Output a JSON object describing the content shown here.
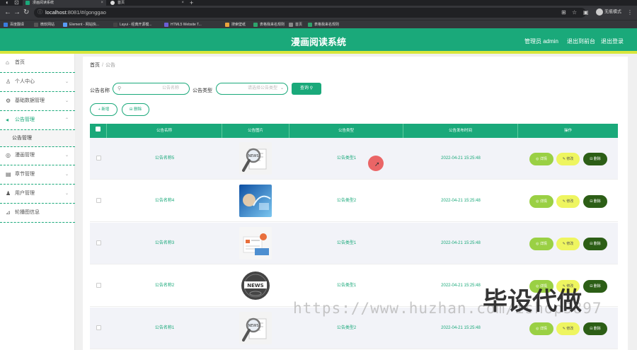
{
  "browser": {
    "tabs": [
      {
        "title": "漫画阅读系统",
        "active": true
      },
      {
        "title": "首页",
        "active": false
      }
    ],
    "url_host": "localhost",
    "url_rest": ":8081/#/gonggao",
    "profile_label": "无痕模式",
    "bookmarks": [
      {
        "label": "百度翻译",
        "icon": "translate-icon",
        "color": "#3b7ddd"
      },
      {
        "label": "微软网站",
        "icon": "windows-icon",
        "color": "#555"
      },
      {
        "label": "Element - 网站快...",
        "icon": "element-icon",
        "color": "#5a9cf5"
      },
      {
        "label": "Layui - 经典开源模...",
        "icon": "layui-icon",
        "color": "#444"
      },
      {
        "label": "HTML5 Website T...",
        "icon": "html5-icon",
        "color": "#6b5fd6"
      },
      {
        "label": "搜索壁纸",
        "icon": "wallpaper-icon",
        "color": "#e8a33c"
      },
      {
        "label": "表格我来名规则",
        "icon": "table-icon",
        "color": "#2fa36b"
      },
      {
        "label": "首页",
        "icon": "globe-icon",
        "color": "#888"
      },
      {
        "label": "表格我来名规则",
        "icon": "table-icon",
        "color": "#2fa36b"
      }
    ]
  },
  "app": {
    "title": "漫画阅读系统",
    "admin_label": "管理员 admin",
    "exit_backend": "退出到前台",
    "logout": "退出登录"
  },
  "sidebar": {
    "items": [
      {
        "label": "首页",
        "icon": "home-icon",
        "expandable": false
      },
      {
        "label": "个人中心",
        "icon": "user-icon",
        "expandable": true
      },
      {
        "label": "基础数据管理",
        "icon": "settings-icon",
        "expandable": true
      },
      {
        "label": "公告管理",
        "icon": "megaphone-icon",
        "expandable": true,
        "active": true
      },
      {
        "label": "漫画管理",
        "icon": "book-icon",
        "expandable": true
      },
      {
        "label": "章节管理",
        "icon": "chapter-icon",
        "expandable": true
      },
      {
        "label": "用户管理",
        "icon": "users-icon",
        "expandable": true
      },
      {
        "label": "轮播图信息",
        "icon": "carousel-icon",
        "expandable": false
      }
    ],
    "sub_item": "公告管理"
  },
  "breadcrumb": {
    "home": "首页",
    "sep": "/",
    "current": "公告"
  },
  "filters": {
    "name_label": "公告名称",
    "name_placeholder": "公告名称",
    "type_label": "公告类型",
    "type_placeholder": "请选择公告类型",
    "search_btn": "查询"
  },
  "ops": {
    "add": "新增",
    "delete": "删除"
  },
  "table": {
    "headers": [
      "公告名称",
      "公告图片",
      "公告类型",
      "公告发布时间",
      "操作"
    ],
    "rows": [
      {
        "name": "公告名称5",
        "type": "公告类型1",
        "time": "2022-04-21 15:25:48",
        "image": "magnifier"
      },
      {
        "name": "公告名称4",
        "type": "公告类型2",
        "time": "2022-04-21 15:25:48",
        "image": "blue-abstract"
      },
      {
        "name": "公告名称3",
        "type": "公告类型1",
        "time": "2022-04-21 15:25:48",
        "image": "notes"
      },
      {
        "name": "公告名称2",
        "type": "公告类型1",
        "time": "2022-04-21 15:25:48",
        "image": "news-globe"
      },
      {
        "name": "公告名称1",
        "type": "公告类型2",
        "time": "2022-04-21 15:25:48",
        "image": "magnifier"
      }
    ],
    "actions": {
      "detail": "详情",
      "edit": "修改",
      "delete": "删除"
    }
  },
  "watermark": {
    "url": "https://www.huzhan.com/ishop3897",
    "text": "毕设代做"
  },
  "colors": {
    "primary": "#1aa97a",
    "accent_bar": "#d8e63b",
    "detail": "#9ad044",
    "edit": "#eef560",
    "delete": "#2c5e16"
  }
}
